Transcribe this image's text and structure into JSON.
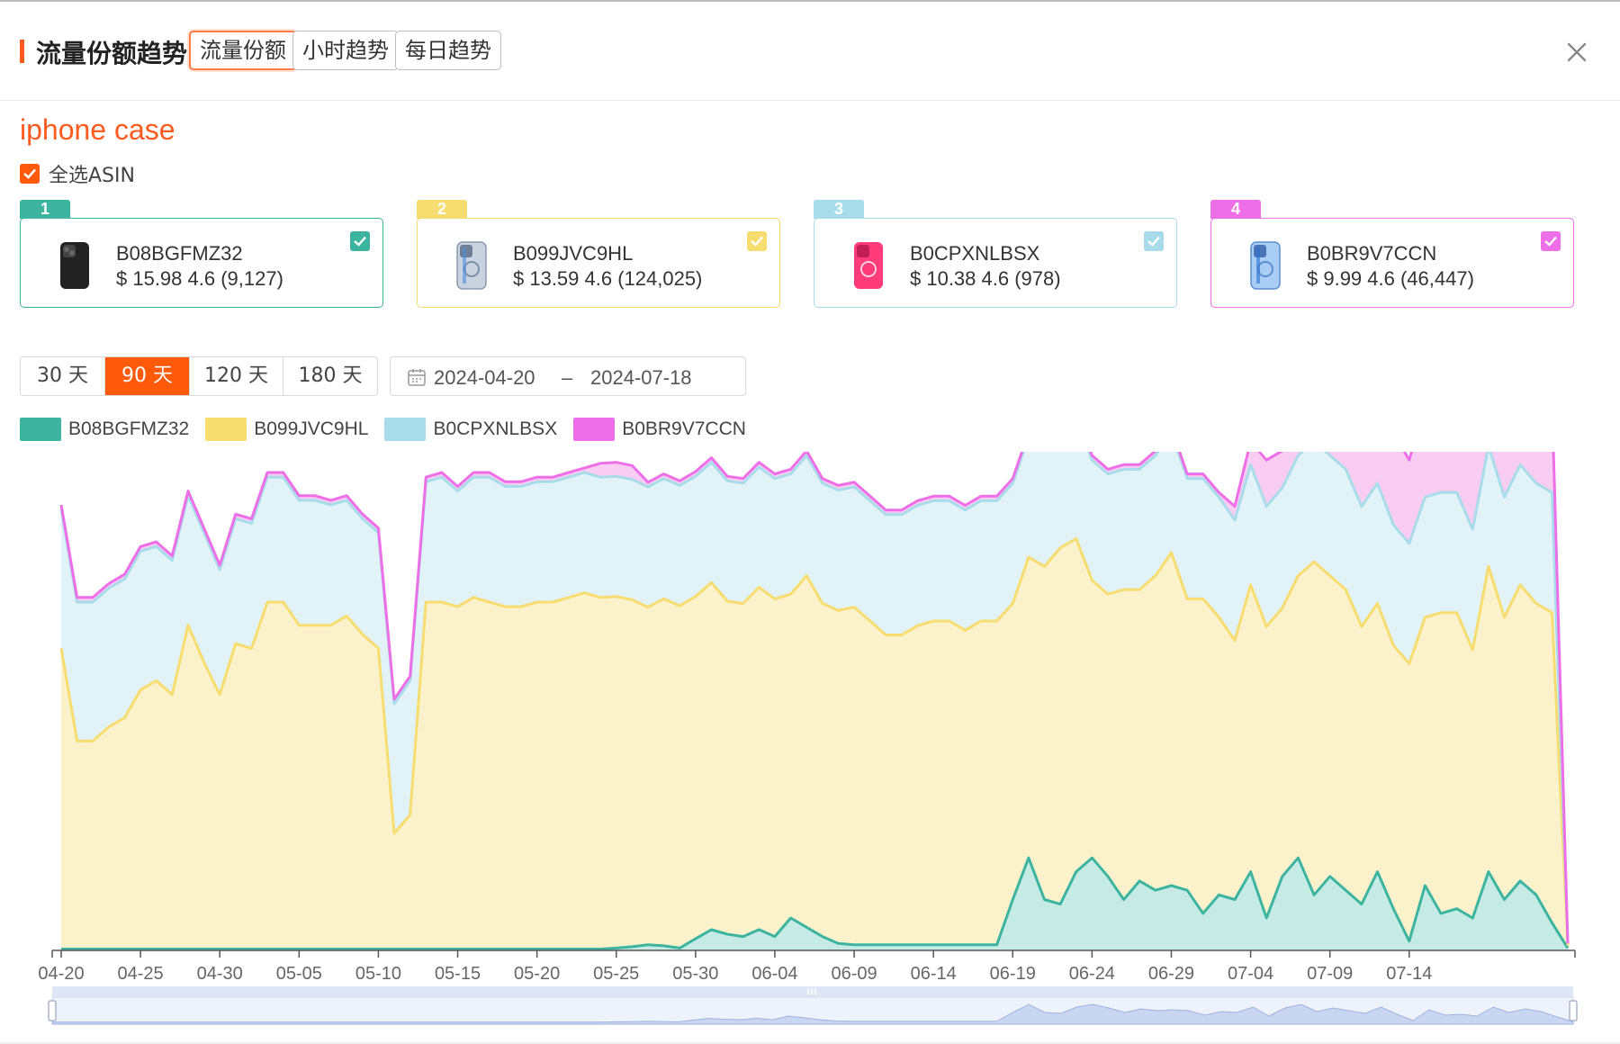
{
  "header": {
    "title": "流量份额趋势",
    "tabs": [
      {
        "label": "流量份额",
        "active": true
      },
      {
        "label": "小时趋势",
        "active": false
      },
      {
        "label": "每日趋势",
        "active": false
      }
    ],
    "close_icon": "close-icon"
  },
  "keyword": "iphone case",
  "select_all": {
    "label": "全选ASIN",
    "checked": true
  },
  "products": [
    {
      "rank": "1",
      "asin": "B08BGFMZ32",
      "price_line": "$ 15.98 4.6 (9,127)",
      "color": "#3cb4a0",
      "case_color": "#222222",
      "checked": true
    },
    {
      "rank": "2",
      "asin": "B099JVC9HL",
      "price_line": "$ 13.59 4.6 (124,025)",
      "color": "#f7dc6f",
      "case_color": "#b8c4d4",
      "checked": true
    },
    {
      "rank": "3",
      "asin": "B0CPXNLBSX",
      "price_line": "$ 10.38 4.6 (978)",
      "color": "#a8dcea",
      "case_color": "#ff3b7a",
      "checked": true
    },
    {
      "rank": "4",
      "asin": "B0BR9V7CCN",
      "price_line": "$ 9.99 4.6 (46,447)",
      "color": "#ee6ee8",
      "case_color": "#6aa8ee",
      "checked": true
    }
  ],
  "time_range": {
    "buttons": [
      "30 天",
      "90 天",
      "120 天",
      "180 天"
    ],
    "active_index": 1
  },
  "date_range": {
    "start": "2024-04-20",
    "separator": "–",
    "end": "2024-07-18"
  },
  "chart_data": {
    "type": "area",
    "stacked": true,
    "x_ticks": [
      "04-20",
      "04-25",
      "04-30",
      "05-05",
      "05-10",
      "05-15",
      "05-20",
      "05-25",
      "05-30",
      "06-04",
      "06-09",
      "06-14",
      "06-19",
      "06-24",
      "06-29",
      "07-04",
      "07-09",
      "07-14"
    ],
    "legend": [
      "B08BGFMZ32",
      "B099JVC9HL",
      "B0CPXNLBSX",
      "B0BR9V7CCN"
    ],
    "series": [
      {
        "name": "B08BGFMZ32",
        "color": "#3cb4a0",
        "fill": "#c6ebe4",
        "values": [
          0.3,
          0.3,
          0.3,
          0.3,
          0.3,
          0.3,
          0.3,
          0.3,
          0.3,
          0.3,
          0.3,
          0.3,
          0.3,
          0.3,
          0.3,
          0.3,
          0.3,
          0.3,
          0.3,
          0.3,
          0.3,
          0.3,
          0.3,
          0.3,
          0.3,
          0.3,
          0.3,
          0.3,
          0.3,
          0.3,
          0.3,
          0.3,
          0.3,
          0.3,
          0.3,
          0.5,
          0.8,
          1.2,
          1.0,
          0.5,
          2.5,
          4.5,
          3.5,
          3.0,
          4.5,
          3.0,
          7.0,
          5.0,
          3.0,
          1.5,
          1.2,
          1.2,
          1.2,
          1.2,
          1.2,
          1.2,
          1.2,
          1.2,
          1.2,
          1.2,
          11.0,
          20.0,
          11.0,
          10.0,
          17.0,
          20.0,
          16.0,
          11.0,
          15.0,
          13.0,
          14.0,
          13.0,
          8.0,
          12.0,
          11.0,
          17.0,
          7.0,
          16.0,
          20.0,
          12.0,
          16.0,
          13.0,
          10.0,
          17.0,
          9.0,
          2.0,
          14.0,
          8.0,
          9.0,
          7.0,
          17.0,
          11.0,
          15.0,
          12.0,
          6.0,
          0.5
        ]
      },
      {
        "name": "B099JVC9HL",
        "color": "#f7dc6f",
        "fill": "#fbf2cc",
        "values": [
          65,
          45,
          45,
          48,
          50,
          56,
          58,
          55,
          70,
          62,
          55,
          66,
          65,
          75,
          75,
          70,
          70,
          70,
          72,
          68,
          65,
          25,
          29,
          75,
          75,
          74,
          76,
          75,
          74,
          74,
          75,
          75,
          76,
          77,
          76,
          76,
          75,
          73,
          75,
          74,
          74,
          75,
          72,
          72,
          74,
          73,
          70,
          76,
          72,
          72,
          73,
          70,
          67,
          67,
          69,
          70,
          70,
          68,
          70,
          70,
          64,
          65,
          72,
          77,
          72,
          60,
          61,
          67,
          63,
          68,
          72,
          63,
          68,
          60,
          56,
          62,
          63,
          58,
          61,
          72,
          65,
          65,
          60,
          58,
          57,
          60,
          58,
          65,
          64,
          58,
          66,
          61,
          64,
          63,
          67,
          0.5
        ]
      },
      {
        "name": "B0CPXNLBSX",
        "color": "#a8dcea",
        "fill": "#e2f3f8",
        "values": [
          30,
          30,
          30,
          30,
          30,
          30,
          29,
          29,
          28,
          28,
          27,
          27,
          27,
          27,
          27,
          27,
          27,
          26,
          25,
          25,
          25,
          28,
          29,
          26,
          27,
          25,
          26,
          27,
          26,
          26,
          26,
          26,
          26,
          26,
          26,
          26,
          26,
          26,
          26,
          26,
          26,
          26,
          26,
          26,
          26,
          26,
          26,
          26,
          26,
          26,
          26,
          26,
          26,
          26,
          26,
          26,
          26,
          26,
          26,
          26,
          26,
          26,
          26,
          26,
          26,
          26,
          26,
          26,
          26,
          26,
          26,
          26,
          26,
          26,
          26,
          26,
          26,
          26,
          26,
          26,
          26,
          26,
          26,
          26,
          26,
          26,
          26,
          26,
          26,
          26,
          26,
          26,
          26,
          26,
          26,
          0.5
        ]
      },
      {
        "name": "B0BR9V7CCN",
        "color": "#ee6ee8",
        "fill": "#f9cdf2",
        "values": [
          1,
          1,
          1,
          1,
          1,
          1,
          1,
          1,
          1,
          1,
          1,
          1,
          1,
          1,
          1,
          1,
          1,
          1,
          1,
          1,
          1,
          1,
          1,
          1,
          1,
          1,
          1,
          1,
          1,
          1,
          1,
          1,
          1,
          1,
          3,
          3,
          3,
          1,
          1,
          1,
          1,
          1,
          1,
          1,
          1,
          1,
          1,
          1,
          1,
          1,
          1,
          1,
          1,
          1,
          1,
          1,
          1,
          1,
          1,
          1,
          1,
          1,
          1,
          1,
          1,
          1,
          1,
          1,
          1,
          1,
          1,
          1,
          1,
          1,
          3,
          5,
          10,
          8,
          9,
          10,
          12,
          14,
          16,
          18,
          20,
          18,
          20,
          19,
          22,
          21,
          19,
          20,
          18,
          22,
          20,
          0
        ]
      }
    ]
  }
}
